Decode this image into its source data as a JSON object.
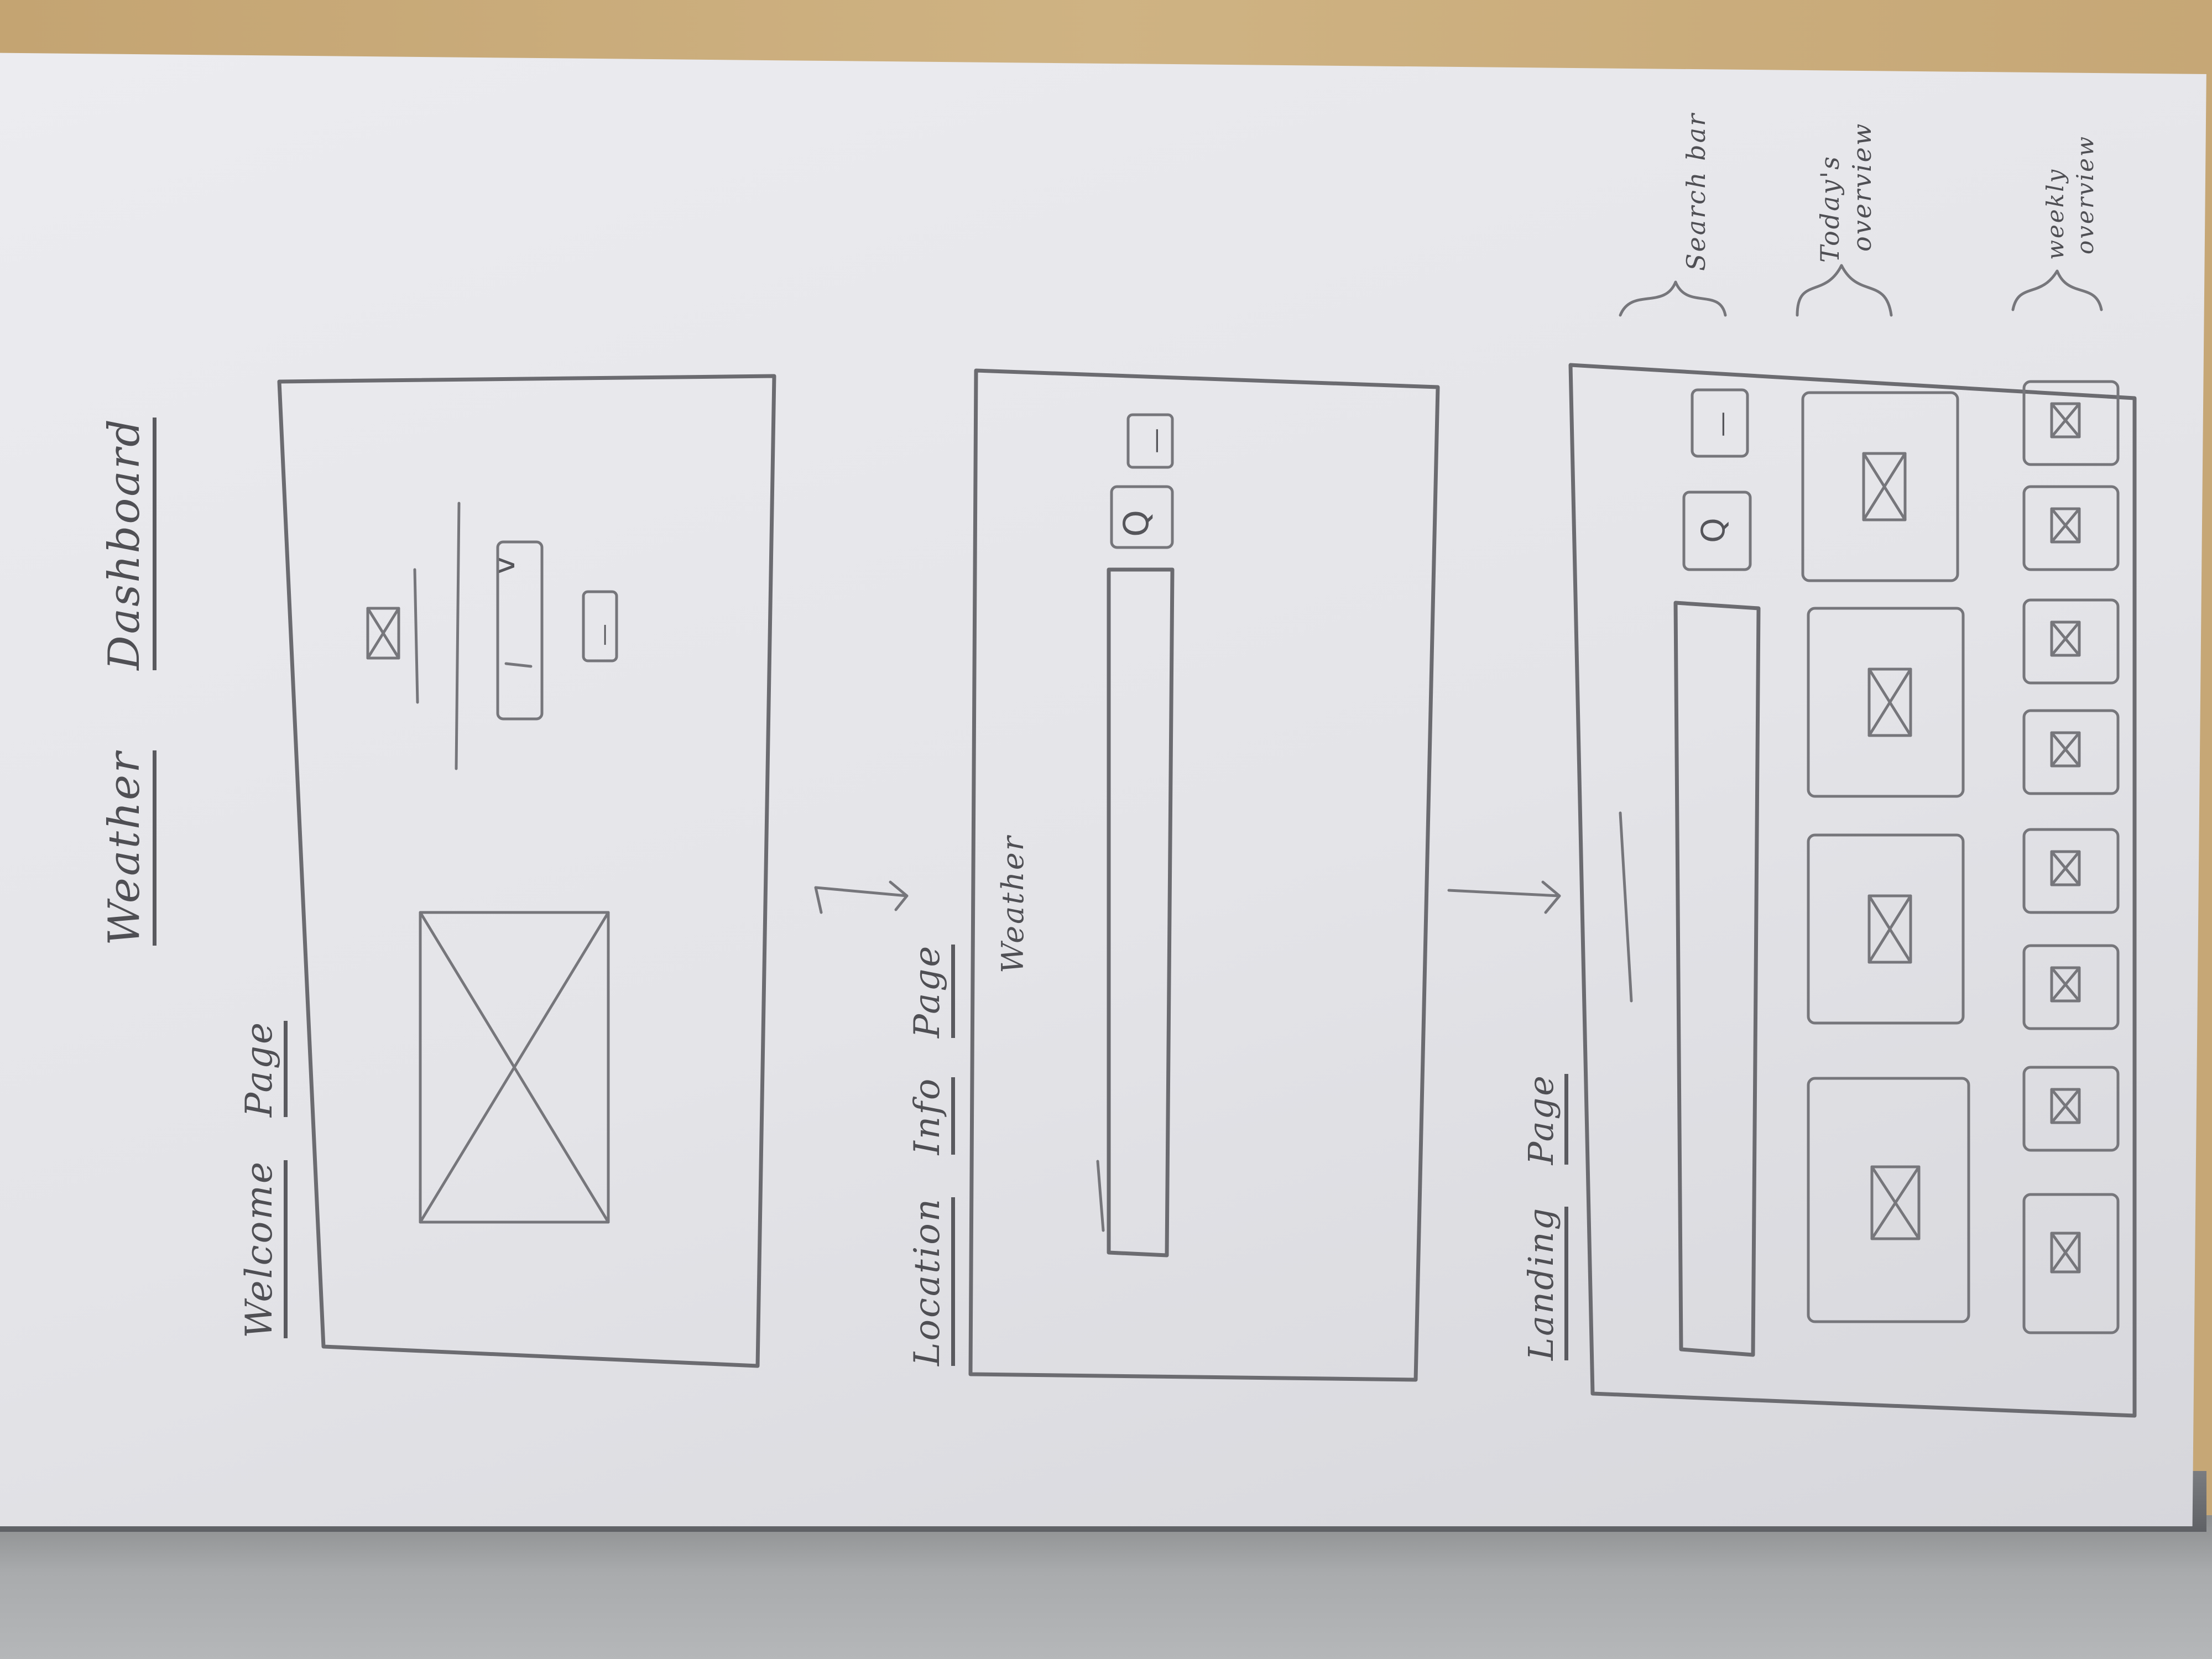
{
  "sketch": {
    "title": {
      "word1": "Weather",
      "word2": "Dashboard"
    },
    "welcome_page": {
      "label_word1": "Welcome",
      "label_word2": "Page"
    },
    "location_info_page": {
      "label_word1": "Location",
      "label_word2": "Info",
      "label_word3": "Page",
      "content_label": "Weather"
    },
    "landing_page": {
      "label_word1": "Landing",
      "label_word2": "Page"
    },
    "annotations": {
      "search_bar": "Search bar",
      "todays_overview_line1": "Today's",
      "todays_overview_line2": "overview",
      "weekly_overview_line1": "weekly",
      "weekly_overview_line2": "overview"
    },
    "dropdown_glyph": "v",
    "search_glyph": "Q",
    "button_glyph": "—"
  }
}
